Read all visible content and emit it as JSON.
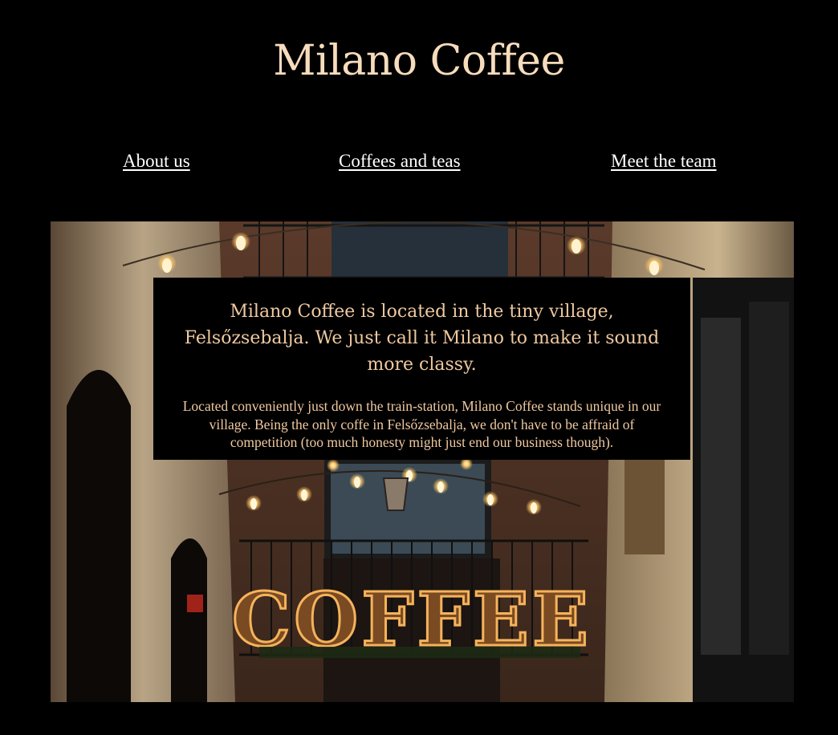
{
  "header": {
    "title": "Milano Coffee"
  },
  "nav": {
    "items": [
      {
        "label": "About us"
      },
      {
        "label": "Coffees and teas"
      },
      {
        "label": "Meet the team"
      }
    ]
  },
  "hero": {
    "image": "coffee-shop-alley-photo",
    "sign_text": "COFFEE",
    "info": {
      "heading": "Milano Coffee is located in the tiny village, Felsőzsebalja. We just call it Milano to make it sound more classy.",
      "body": "Located conveniently just down the train-station, Milano Coffee stands unique in our village. Being the only coffe in Felsőzsebalja, we don't have to be affraid of competition (too much honesty might just end our business though)."
    }
  },
  "colors": {
    "background": "#000000",
    "title": "#f7dcbc",
    "nav_link": "#ffffff",
    "info_text": "#f0c9a0",
    "bulb": "#ffd58a"
  }
}
